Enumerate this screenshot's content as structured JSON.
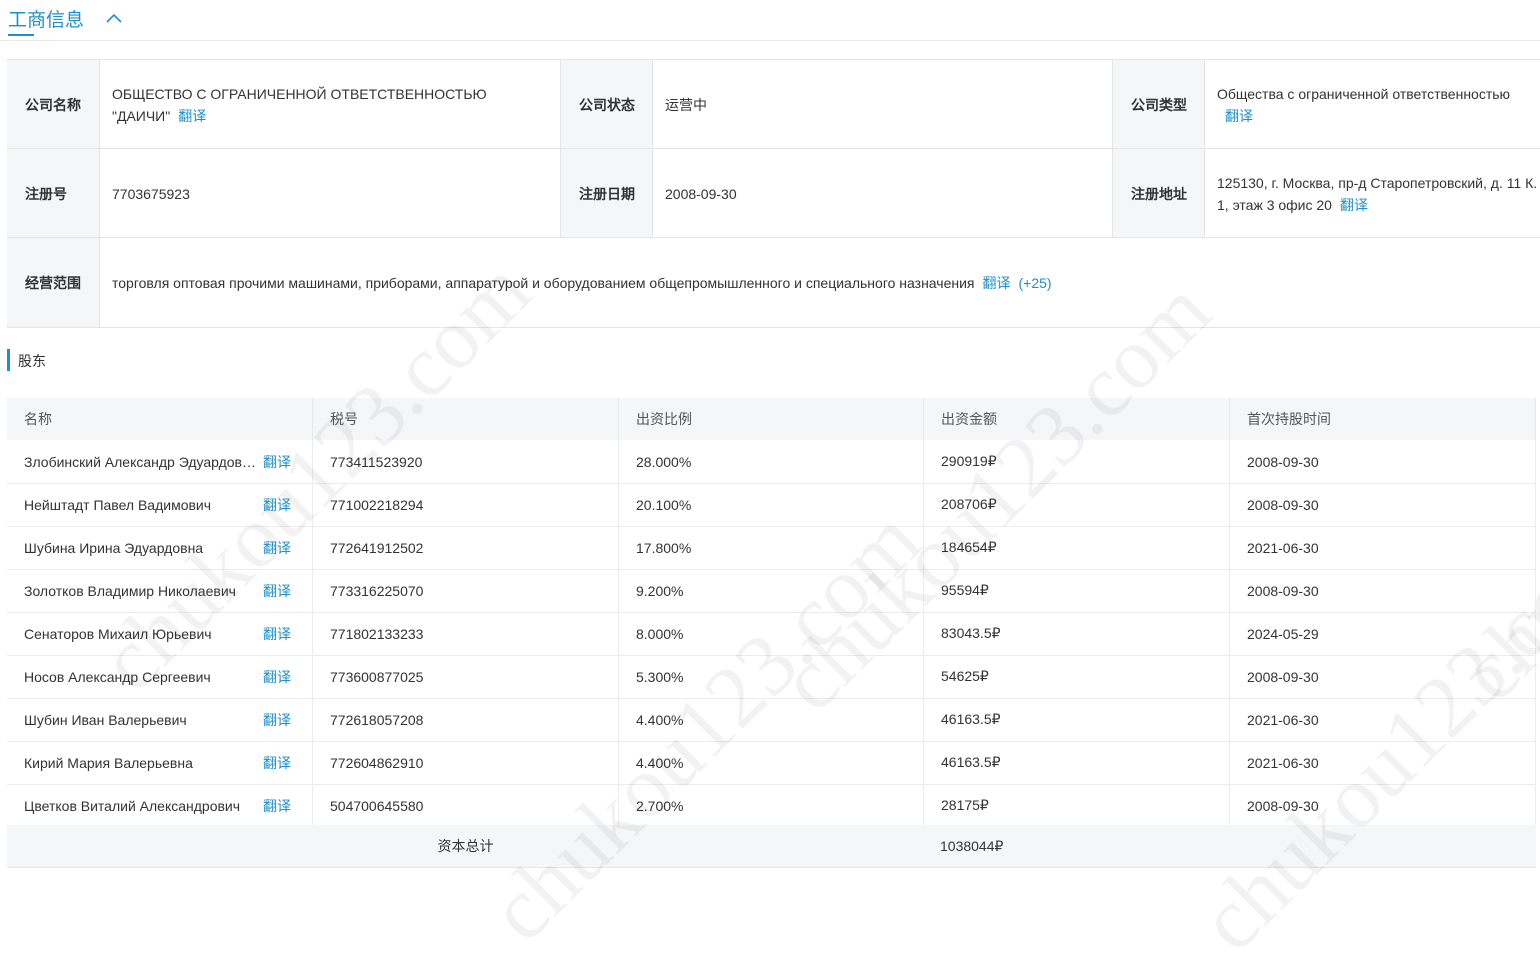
{
  "section": {
    "title": "工商信息"
  },
  "info": {
    "company_name_label": "公司名称",
    "company_name": "ОБЩЕСТВО С ОГРАНИЧЕННОЙ ОТВЕТСТВЕННОСТЬЮ \"ДАИЧИ\"",
    "status_label": "公司状态",
    "status": "运营中",
    "type_label": "公司类型",
    "type": "Общества с ограниченной ответственностью",
    "reg_no_label": "注册号",
    "reg_no": "7703675923",
    "reg_date_label": "注册日期",
    "reg_date": "2008-09-30",
    "address_label": "注册地址",
    "address": "125130, г. Москва, пр-д Старопетровский, д. 11 К. 1, этаж 3 офис 20",
    "scope_label": "经营范围",
    "scope": "торговля оптовая прочими машинами, приборами, аппаратурой и оборудованием общепромышленного и специального назначения",
    "scope_more": "(+25)",
    "translate_label": "翻译"
  },
  "shareholders": {
    "title": "股东",
    "columns": [
      "名称",
      "税号",
      "出资比例",
      "出资金额",
      "首次持股时间"
    ],
    "translate_label": "翻译",
    "rows": [
      {
        "name": "Злобинский Александр Эдуардович",
        "tax": "773411523920",
        "ratio": "28.000%",
        "amount": "290919₽",
        "date": "2008-09-30"
      },
      {
        "name": "Нейштадт Павел Вадимович",
        "tax": "771002218294",
        "ratio": "20.100%",
        "amount": "208706₽",
        "date": "2008-09-30"
      },
      {
        "name": "Шубина Ирина Эдуардовна",
        "tax": "772641912502",
        "ratio": "17.800%",
        "amount": "184654₽",
        "date": "2021-06-30"
      },
      {
        "name": "Золотков Владимир Николаевич",
        "tax": "773316225070",
        "ratio": "9.200%",
        "amount": "95594₽",
        "date": "2008-09-30"
      },
      {
        "name": "Сенаторов Михаил Юрьевич",
        "tax": "771802133233",
        "ratio": "8.000%",
        "amount": "83043.5₽",
        "date": "2024-05-29"
      },
      {
        "name": "Носов Александр Сергеевич",
        "tax": "773600877025",
        "ratio": "5.300%",
        "amount": "54625₽",
        "date": "2008-09-30"
      },
      {
        "name": "Шубин Иван Валерьевич",
        "tax": "772618057208",
        "ratio": "4.400%",
        "amount": "46163.5₽",
        "date": "2021-06-30"
      },
      {
        "name": "Кирий Мария Валерьевна",
        "tax": "772604862910",
        "ratio": "4.400%",
        "amount": "46163.5₽",
        "date": "2021-06-30"
      },
      {
        "name": "Цветков Виталий Александрович",
        "tax": "504700645580",
        "ratio": "2.700%",
        "amount": "28175₽",
        "date": "2008-09-30"
      }
    ],
    "total_label": "资本总计",
    "total_amount": "1038044₽"
  },
  "watermark": "chukou123.com"
}
